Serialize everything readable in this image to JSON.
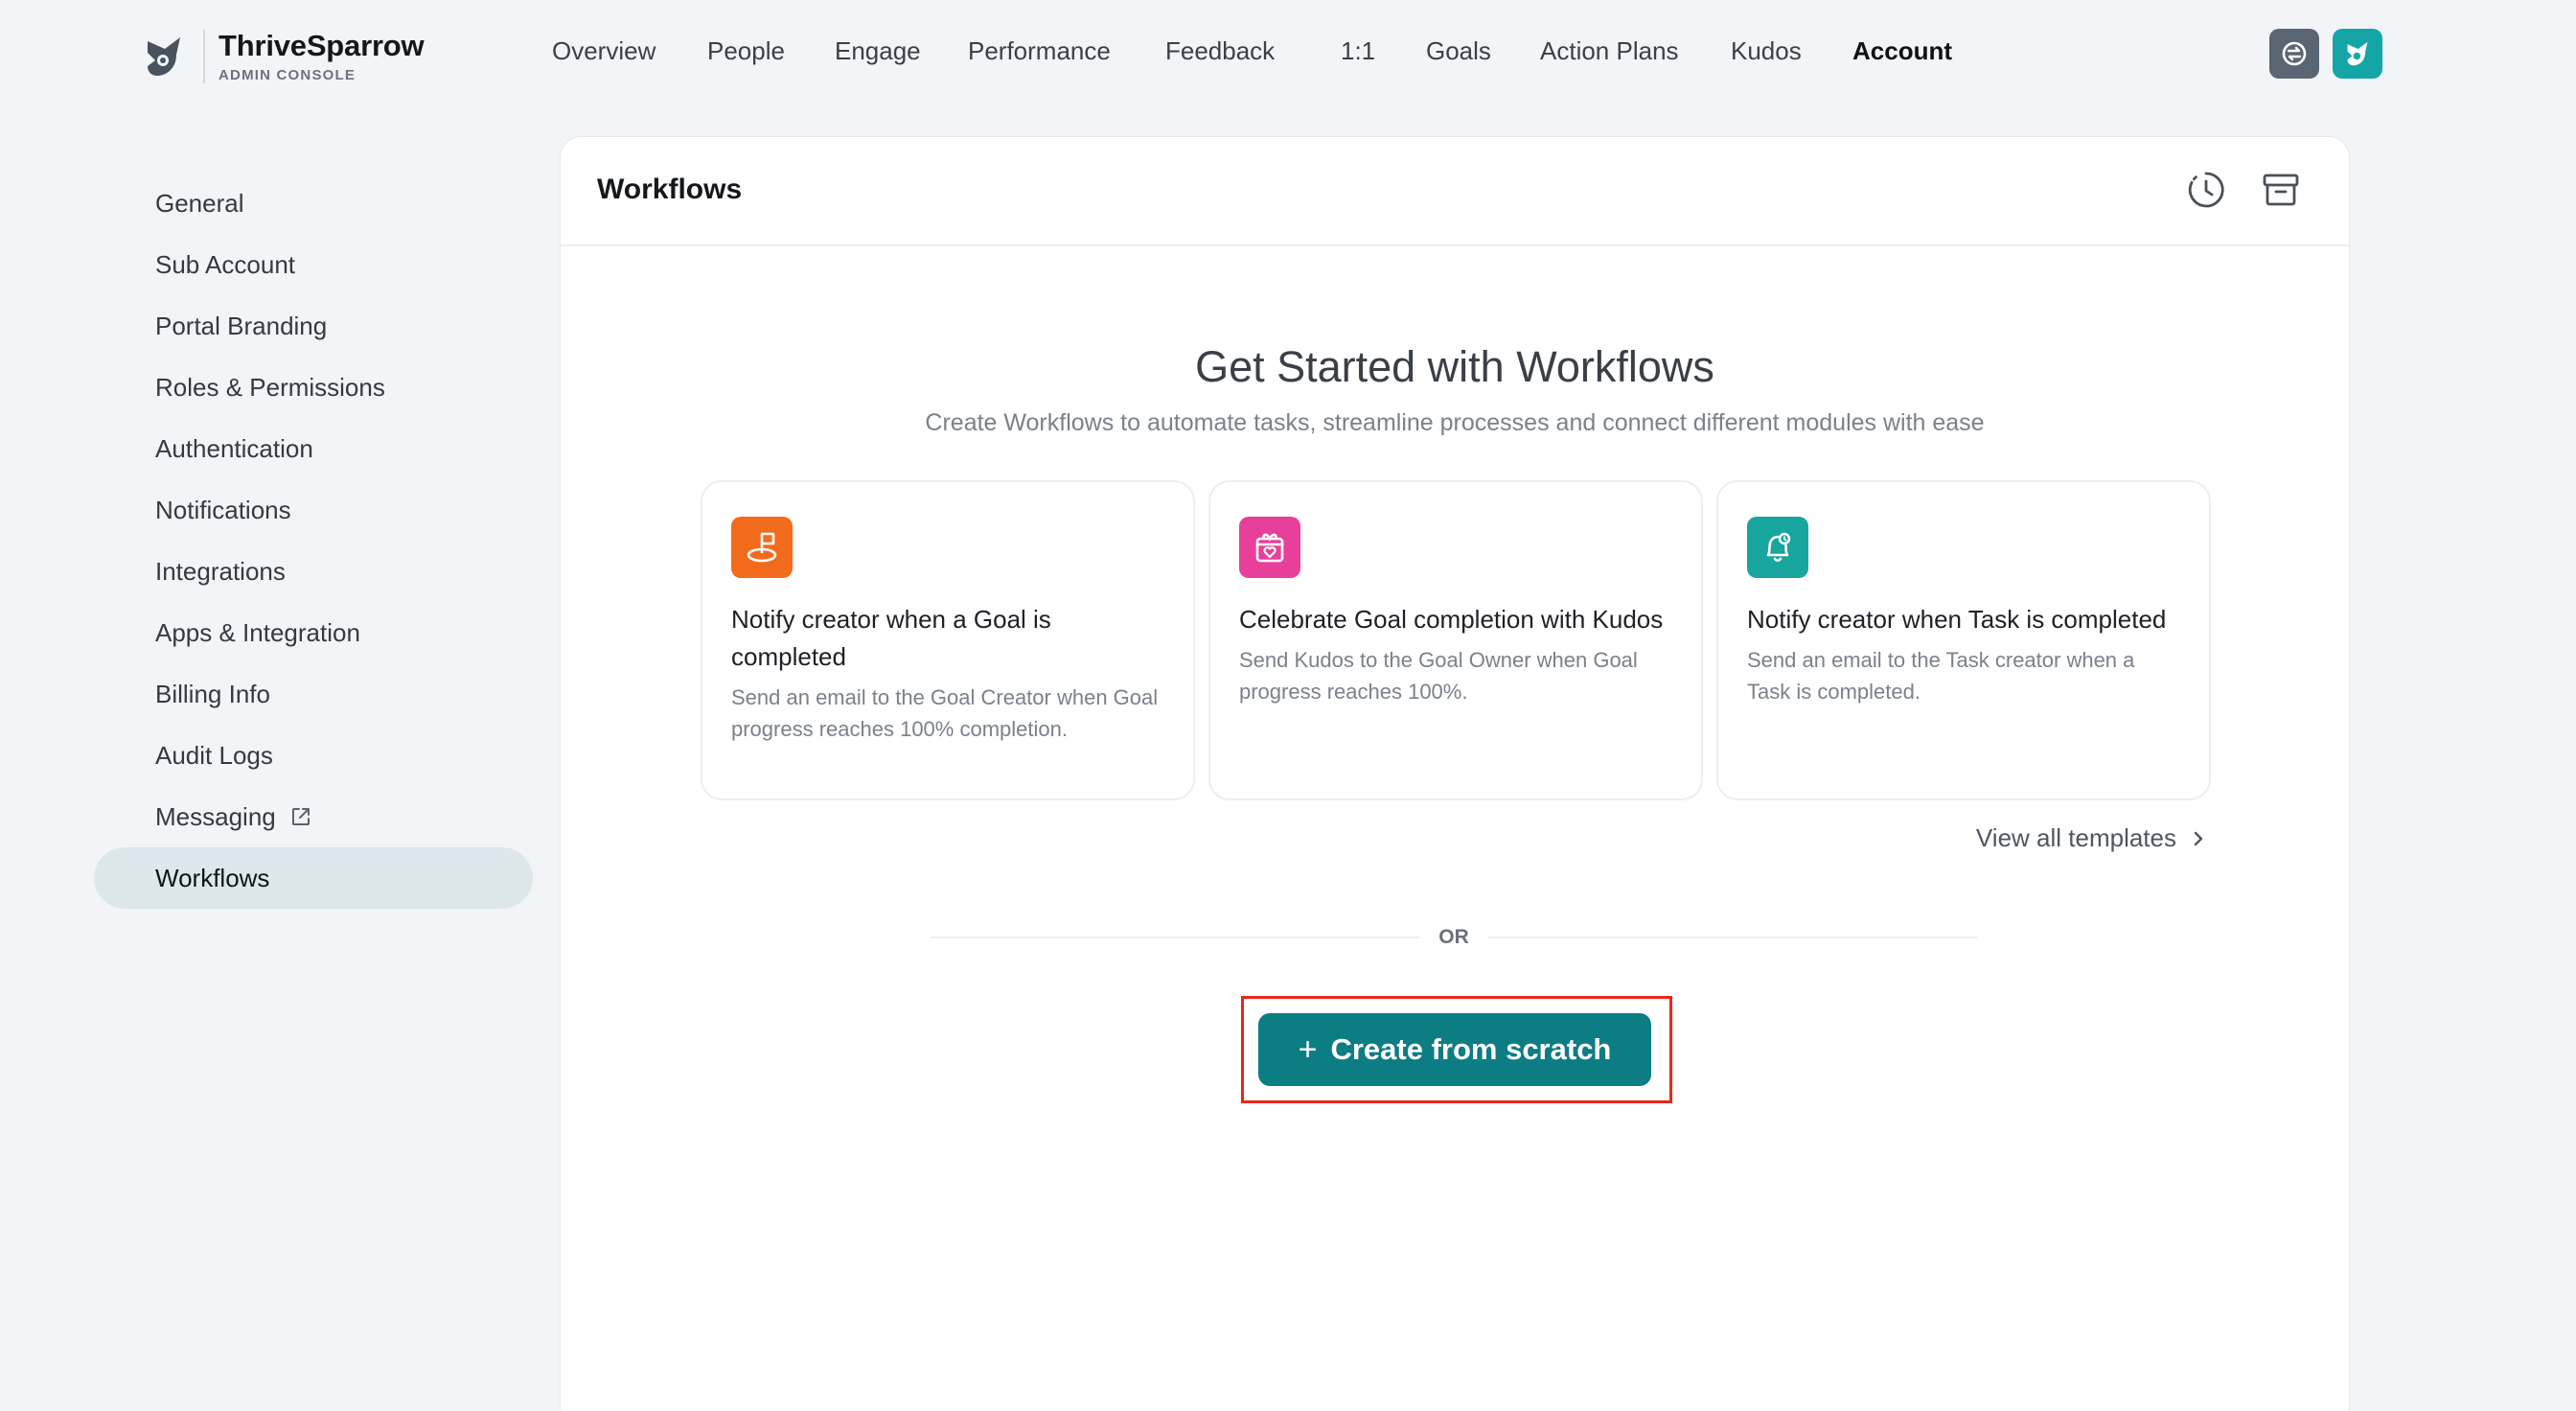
{
  "brand": {
    "name": "ThriveSparrow",
    "subtitle": "ADMIN CONSOLE"
  },
  "nav": {
    "items": [
      {
        "label": "Overview"
      },
      {
        "label": "People"
      },
      {
        "label": "Engage"
      },
      {
        "label": "Performance"
      },
      {
        "label": "Feedback"
      },
      {
        "label": "1:1"
      },
      {
        "label": "Goals"
      },
      {
        "label": "Action Plans"
      },
      {
        "label": "Kudos"
      },
      {
        "label": "Account",
        "active": true
      }
    ]
  },
  "sidebar": {
    "items": [
      {
        "label": "General"
      },
      {
        "label": "Sub Account"
      },
      {
        "label": "Portal Branding"
      },
      {
        "label": "Roles & Permissions"
      },
      {
        "label": "Authentication"
      },
      {
        "label": "Notifications"
      },
      {
        "label": "Integrations"
      },
      {
        "label": "Apps & Integration"
      },
      {
        "label": "Billing Info"
      },
      {
        "label": "Audit Logs"
      },
      {
        "label": "Messaging"
      },
      {
        "label": "Workflows",
        "active": true
      }
    ]
  },
  "panel": {
    "title": "Workflows",
    "hero_title": "Get Started with Workflows",
    "hero_subtitle": "Create Workflows to automate tasks, streamline processes and connect different modules with ease",
    "cards": [
      {
        "title": "Notify creator when a Goal is completed",
        "description": "Send an email to the Goal Creator when Goal progress reaches 100% completion.",
        "icon": "goal-flag-icon",
        "color": "#f26b1d"
      },
      {
        "title": "Celebrate Goal completion with Kudos",
        "description": "Send Kudos to the Goal Owner when Goal progress reaches 100%.",
        "icon": "gift-heart-icon",
        "color": "#e8409a"
      },
      {
        "title": "Notify creator when Task is completed",
        "description": "Send an email to the Task creator when a Task is completed.",
        "icon": "bell-icon",
        "color": "#17a59e"
      }
    ],
    "view_all": "View all templates",
    "or_text": "OR",
    "create_label": "Create from scratch"
  },
  "colors": {
    "accent": "#0d7d84",
    "highlight": "#e8281c",
    "active_bg": "#dde7ec"
  }
}
